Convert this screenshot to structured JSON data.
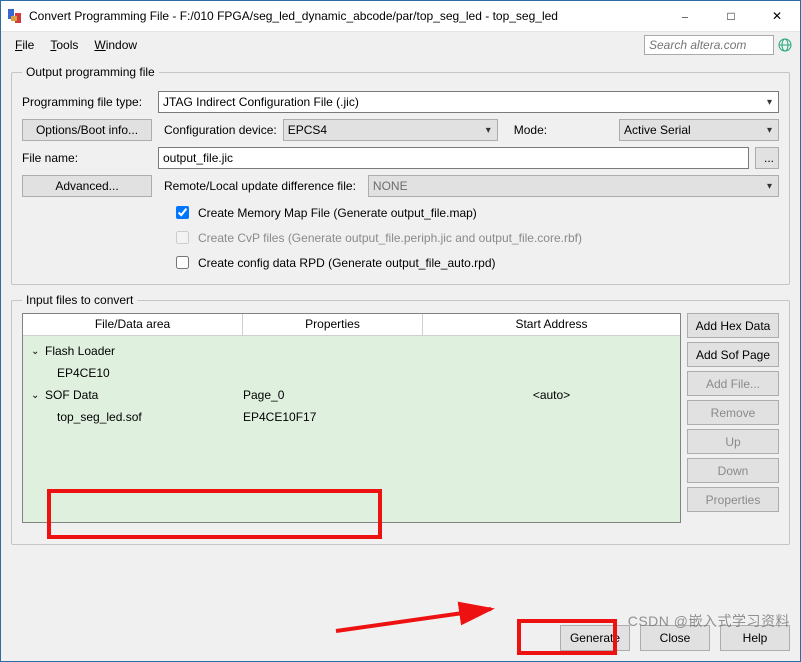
{
  "window": {
    "title": "Convert Programming File - F:/010 FPGA/seg_led_dynamic_abcode/par/top_seg_led - top_seg_led"
  },
  "menubar": {
    "file": "File",
    "tools": "Tools",
    "window": "Window",
    "search_placeholder": "Search altera.com"
  },
  "output": {
    "legend": "Output programming file",
    "type_label": "Programming file type:",
    "type_value": "JTAG Indirect Configuration File (.jic)",
    "options_btn": "Options/Boot info...",
    "conf_dev_label": "Configuration device:",
    "conf_dev_value": "EPCS4",
    "mode_label": "Mode:",
    "mode_value": "Active Serial",
    "file_name_label": "File name:",
    "file_name_value": "output_file.jic",
    "browse_btn": "...",
    "advanced_btn": "Advanced...",
    "remote_label": "Remote/Local update difference file:",
    "remote_value": "NONE",
    "chk_map": "Create Memory Map File (Generate output_file.map)",
    "chk_cvp": "Create CvP files (Generate output_file.periph.jic and output_file.core.rbf)",
    "chk_rpd": "Create config data RPD (Generate output_file_auto.rpd)"
  },
  "input": {
    "legend": "Input files to convert",
    "col1": "File/Data area",
    "col2": "Properties",
    "col3": "Start Address",
    "rows": {
      "flash_loader": "Flash Loader",
      "flash_child": "EP4CE10",
      "sof_data": "SOF Data",
      "sof_prop": "Page_0",
      "sof_addr": "<auto>",
      "sof_child": "top_seg_led.sof",
      "sof_child_prop": "EP4CE10F17"
    },
    "sidebtns": {
      "add_hex": "Add Hex Data",
      "add_sof": "Add Sof Page",
      "add_file": "Add File...",
      "remove": "Remove",
      "up": "Up",
      "down": "Down",
      "props": "Properties"
    }
  },
  "footer": {
    "generate": "Generate",
    "close": "Close",
    "help": "Help"
  },
  "watermark": "CSDN @嵌入式学习资料"
}
